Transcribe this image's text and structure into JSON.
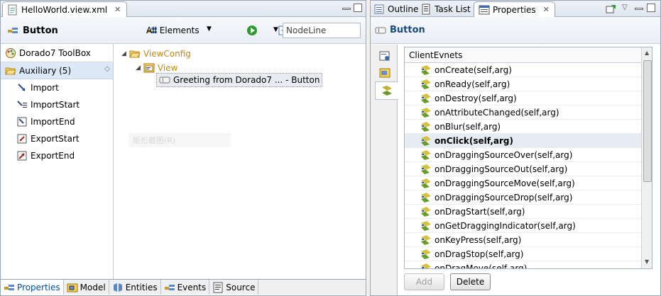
{
  "editor": {
    "tab_title": "HelloWorld.view.xml",
    "toolbar": {
      "title": "Button",
      "filter_label": "All Elements",
      "search_value": "NodeLine"
    },
    "palette": {
      "title": "Dorado7 ToolBox",
      "group": "Auxiliary (5)",
      "items": [
        "Import",
        "ImportStart",
        "ImportEnd",
        "ExportStart",
        "ExportEnd"
      ]
    },
    "outline": {
      "root": "ViewConfig",
      "view": "View",
      "node": "Greeting from Dorado7 ... - Button",
      "ghost": "矩形截图(R)"
    },
    "bottom_tabs": [
      "Properties",
      "Model",
      "Entities",
      "Events",
      "Source"
    ]
  },
  "props": {
    "tabs": [
      "Outline",
      "Task List",
      "Properties"
    ],
    "title": "Button",
    "list_header": "ClientEvnets",
    "events": [
      "onCreate(self,arg)",
      "onReady(self,arg)",
      "onDestroy(self,arg)",
      "onAttributeChanged(self,arg)",
      "onBlur(self,arg)",
      "onClick(self,arg)",
      "onDraggingSourceOver(self,arg)",
      "onDraggingSourceOut(self,arg)",
      "onDraggingSourceMove(self,arg)",
      "onDraggingSourceDrop(self,arg)",
      "onDragStart(self,arg)",
      "onGetDraggingIndicator(self,arg)",
      "onKeyPress(self,arg)",
      "onDragStop(self,arg)",
      "onDragMove(self,arg)"
    ],
    "selected_event": "onClick(self,arg)",
    "add_label": "Add",
    "delete_label": "Delete"
  },
  "colors": {
    "accent": "#0050a0",
    "folder": "#e8b23a",
    "selected_bg": "#dde8f6"
  }
}
